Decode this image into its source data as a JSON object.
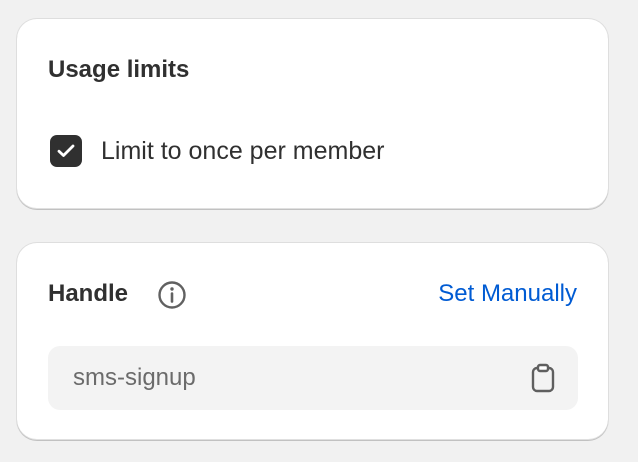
{
  "usage_limits": {
    "title": "Usage limits",
    "checkbox": {
      "label": "Limit to once per member",
      "checked": true
    }
  },
  "handle": {
    "title": "Handle",
    "info_icon": "info-icon",
    "action_label": "Set Manually",
    "field_value": "sms-signup",
    "copy_icon": "clipboard-icon"
  },
  "colors": {
    "background": "#f1f1f1",
    "card": "#ffffff",
    "text": "#303030",
    "link": "#005bd3",
    "field_bg": "#f3f3f3",
    "muted_text": "#6b6b6b"
  }
}
